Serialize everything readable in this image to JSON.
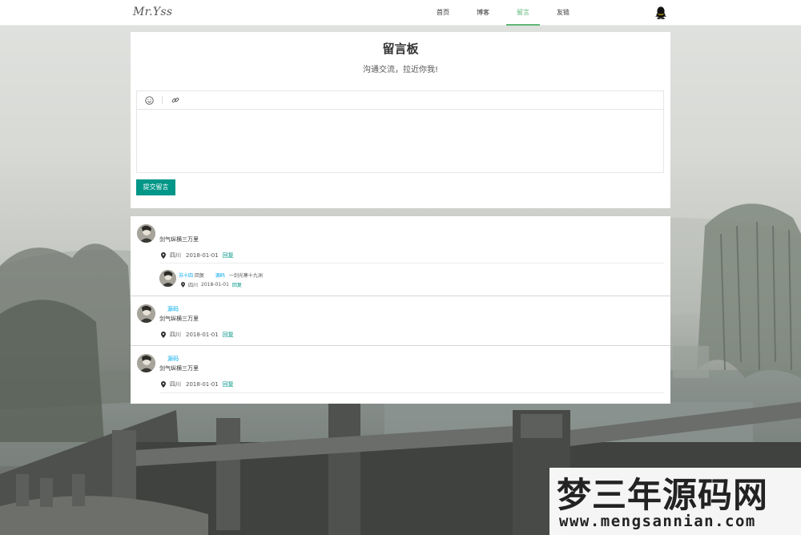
{
  "header": {
    "logo": "Mr.Yss",
    "nav": [
      {
        "label": "首页",
        "active": false
      },
      {
        "label": "博客",
        "active": false
      },
      {
        "label": "留言",
        "active": true
      },
      {
        "label": "友链",
        "active": false
      }
    ],
    "right_icon": "qq-icon"
  },
  "board": {
    "title": "留言板",
    "subtitle": "沟通交流，拉近你我!",
    "toolbar_icons": [
      "smile-icon",
      "link-icon"
    ],
    "submit_label": "提交留言"
  },
  "comments": [
    {
      "name": "",
      "text": "剑气纵横三万里",
      "location": "四川",
      "date": "2018-01-01",
      "reply_label": "回复",
      "replies": [
        {
          "from": "苏十四",
          "action": "回复",
          "to": "源码",
          "text": "一剑光寒十九洲",
          "location": "四川",
          "date": "2018-01-01",
          "reply_label": "回复"
        }
      ]
    },
    {
      "name": "源码",
      "text": "剑气纵横三万里",
      "location": "四川",
      "date": "2018-01-01",
      "reply_label": "回复"
    },
    {
      "name": "源码",
      "text": "剑气纵横三万里",
      "location": "四川",
      "date": "2018-01-01",
      "reply_label": "回复"
    }
  ],
  "watermark": {
    "title": "梦三年源码网",
    "url": "www.mengsannian.com"
  },
  "colors": {
    "accent": "#009688",
    "nav_active": "#5fb878",
    "link_blue": "#01aaed"
  }
}
